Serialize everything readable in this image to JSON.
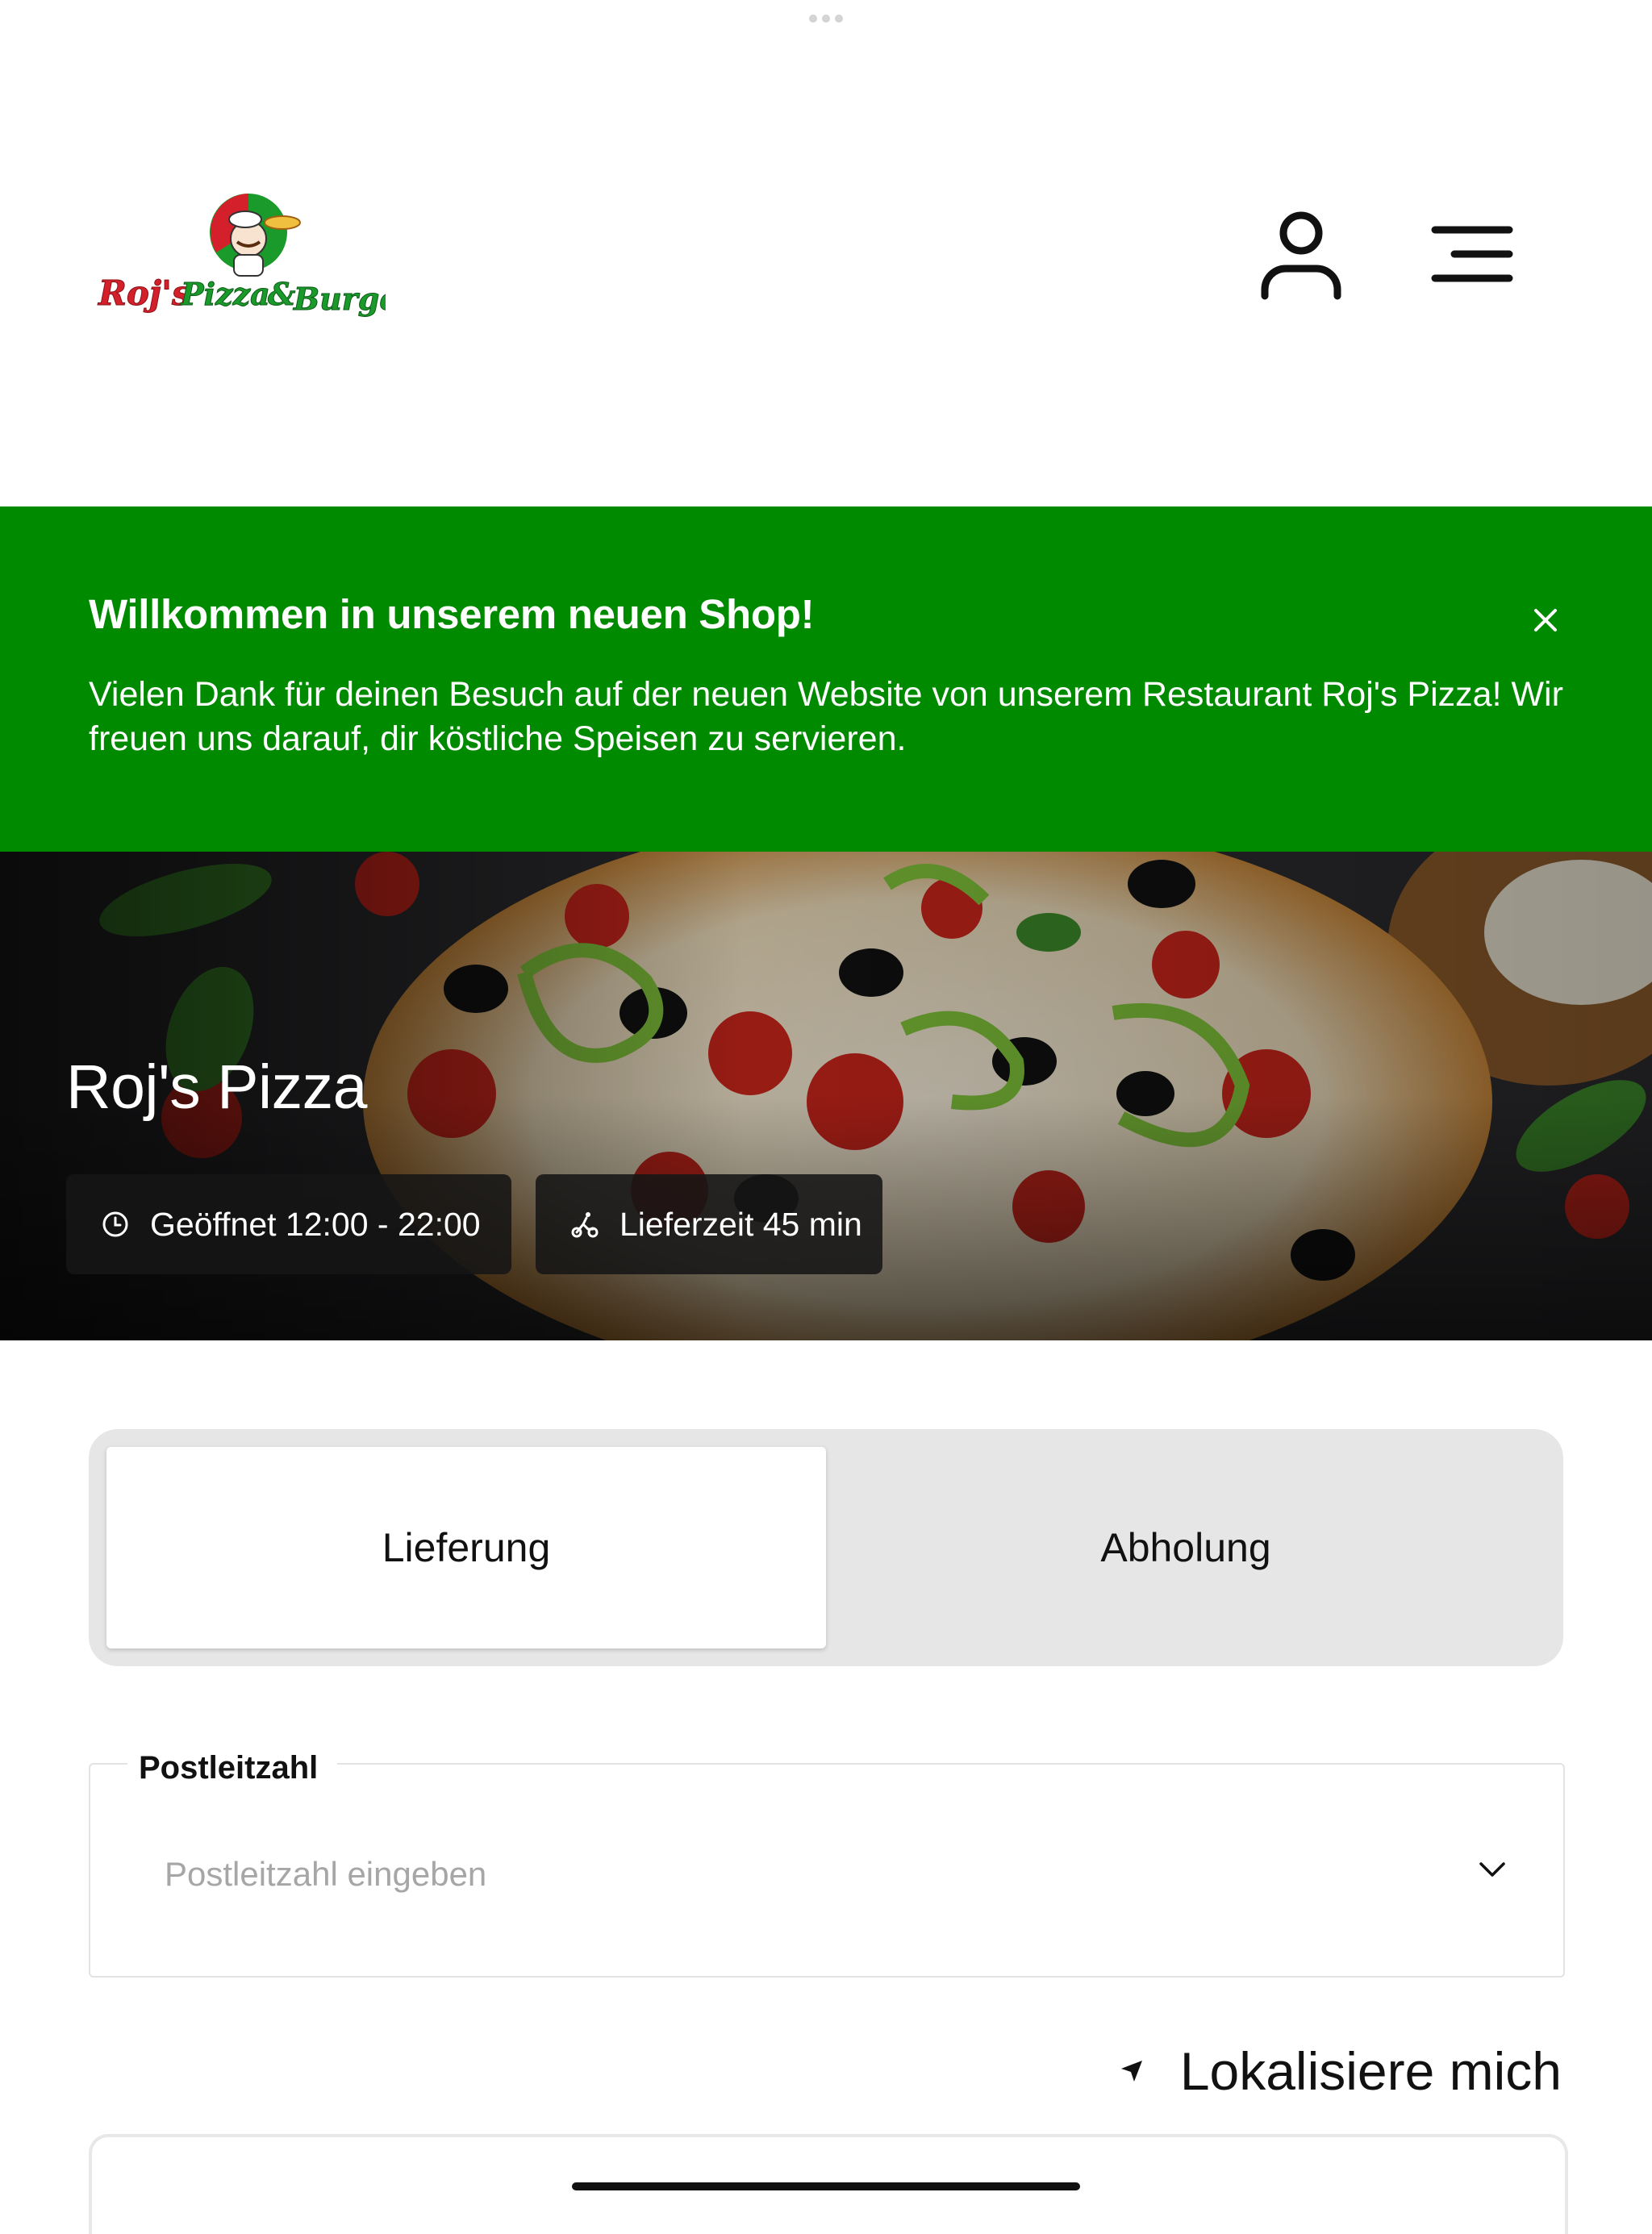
{
  "header": {
    "logo": {
      "text_line": "Roj's Pizza & Burger",
      "accent_red": "#d4202a",
      "accent_green": "#1a9a2a"
    },
    "user_icon": "user-icon",
    "menu_icon": "menu-icon"
  },
  "banner": {
    "title": "Willkommen in unserem neuen Shop!",
    "text": "Vielen Dank für deinen Besuch auf der neuen Website von unserem Restaurant Roj's Pizza! Wir freuen uns darauf, dir köstliche Speisen zu servieren.",
    "background": "#008a00",
    "close_icon": "close-icon"
  },
  "hero": {
    "title": "Roj's Pizza",
    "opening": {
      "icon": "clock-icon",
      "label": "Geöffnet 12:00 - 22:00"
    },
    "delivery": {
      "icon": "scooter-icon",
      "label": "Lieferzeit 45 min"
    }
  },
  "order_mode": {
    "tabs": [
      {
        "label": "Lieferung",
        "active": true
      },
      {
        "label": "Abholung",
        "active": false
      }
    ]
  },
  "postcode": {
    "label": "Postleitzahl",
    "placeholder": "Postleitzahl eingeben",
    "value": ""
  },
  "locate": {
    "label": "Lokalisiere mich",
    "icon": "location-arrow-icon"
  }
}
